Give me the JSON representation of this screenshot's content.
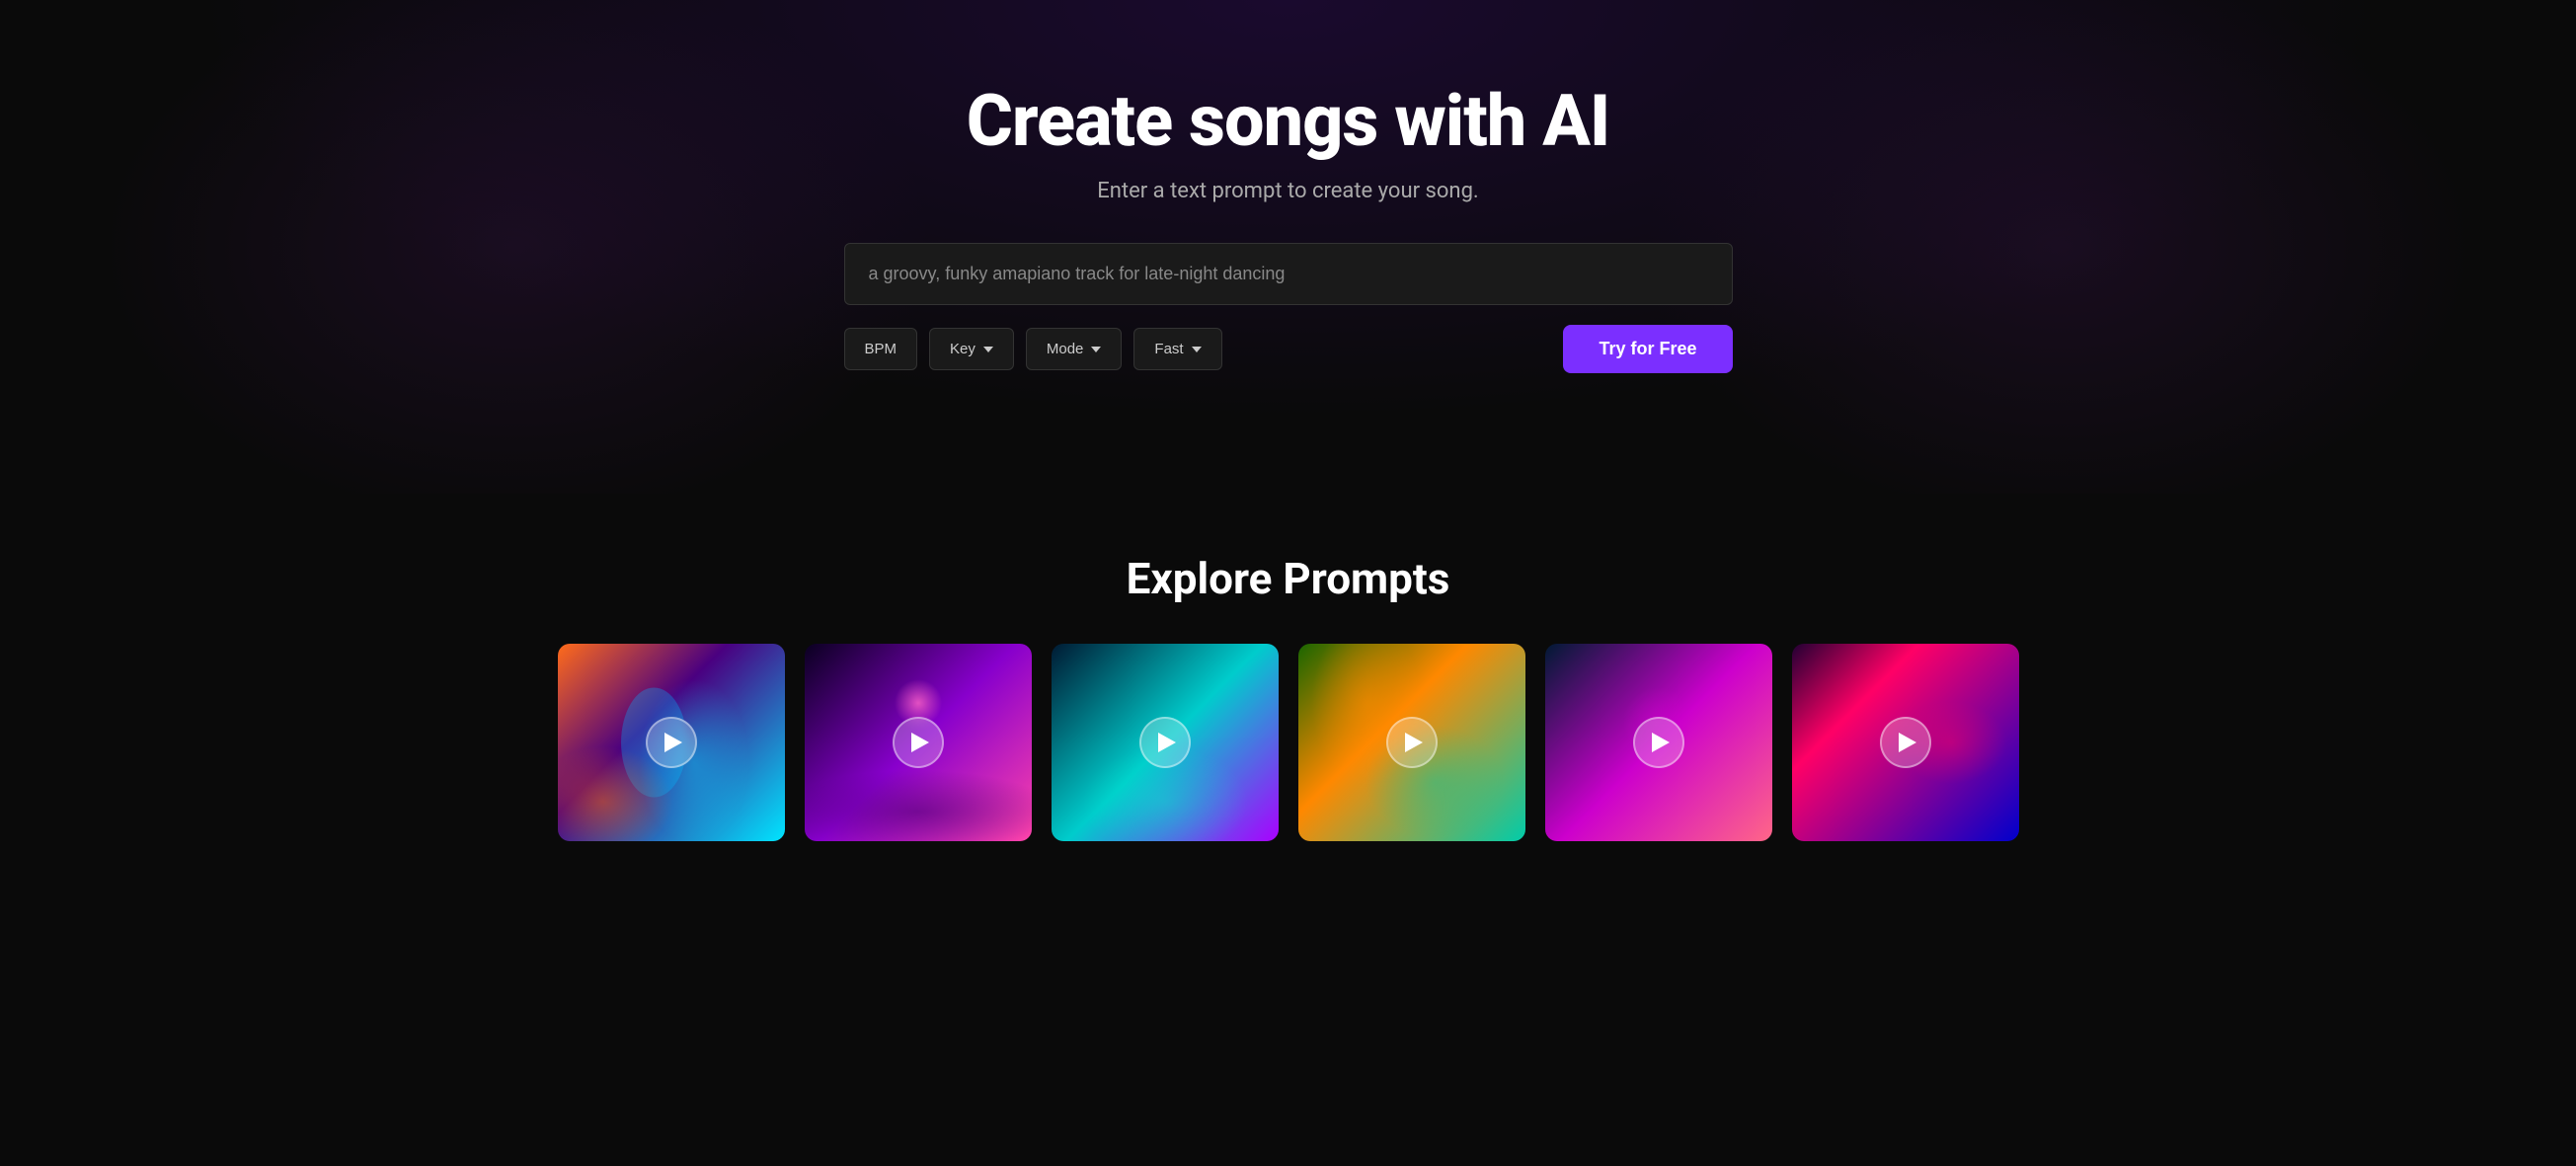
{
  "hero": {
    "title": "Create songs with AI",
    "subtitle": "Enter a text prompt to create your song.",
    "input": {
      "placeholder": "a groovy, funky amapiano track for late-night dancing",
      "value": "a groovy, funky amapiano track for late-night dancing"
    },
    "controls": {
      "bpm_label": "BPM",
      "key_label": "Key",
      "mode_label": "Mode",
      "fast_label": "Fast",
      "try_button": "Try for Free"
    }
  },
  "explore": {
    "title": "Explore Prompts",
    "cards": [
      {
        "id": 1,
        "theme": "card-1"
      },
      {
        "id": 2,
        "theme": "card-2"
      },
      {
        "id": 3,
        "theme": "card-3"
      },
      {
        "id": 4,
        "theme": "card-4"
      },
      {
        "id": 5,
        "theme": "card-5"
      },
      {
        "id": 6,
        "theme": "card-6"
      }
    ]
  },
  "colors": {
    "accent": "#7b2fff",
    "background": "#0a0a0a",
    "card_bg": "#1a1a1a",
    "border": "#333333",
    "text_primary": "#ffffff",
    "text_secondary": "#aaaaaa"
  }
}
